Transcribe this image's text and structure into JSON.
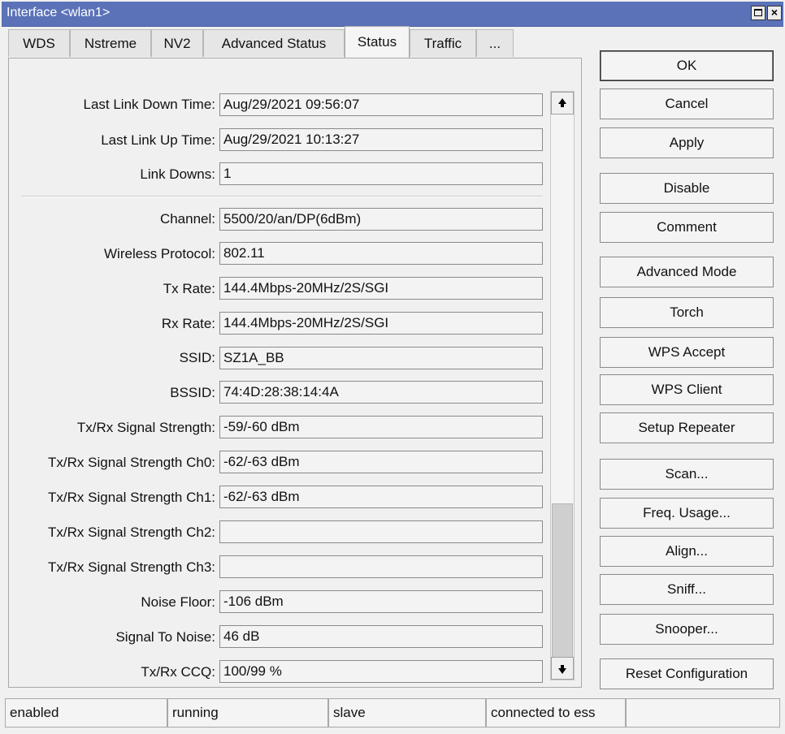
{
  "window": {
    "title": "Interface <wlan1>"
  },
  "tabs": [
    {
      "label": "WDS",
      "active": false
    },
    {
      "label": "Nstreme",
      "active": false
    },
    {
      "label": "NV2",
      "active": false
    },
    {
      "label": "Advanced Status",
      "active": false
    },
    {
      "label": "Status",
      "active": true
    },
    {
      "label": "Traffic",
      "active": false
    },
    {
      "label": "...",
      "active": false
    }
  ],
  "status_fields": [
    {
      "label": "Last Link Down Time:",
      "value": "Aug/29/2021 09:56:07"
    },
    {
      "label": "Last Link Up Time:",
      "value": "Aug/29/2021 10:13:27"
    },
    {
      "label": "Link Downs:",
      "value": "1"
    },
    {
      "label": "Channel:",
      "value": "5500/20/an/DP(6dBm)"
    },
    {
      "label": "Wireless Protocol:",
      "value": "802.11"
    },
    {
      "label": "Tx Rate:",
      "value": "144.4Mbps-20MHz/2S/SGI"
    },
    {
      "label": "Rx Rate:",
      "value": "144.4Mbps-20MHz/2S/SGI"
    },
    {
      "label": "SSID:",
      "value": "SZ1A_BB"
    },
    {
      "label": "BSSID:",
      "value": "74:4D:28:38:14:4A"
    },
    {
      "label": "Tx/Rx Signal Strength:",
      "value": "-59/-60 dBm"
    },
    {
      "label": "Tx/Rx Signal Strength Ch0:",
      "value": "-62/-63 dBm"
    },
    {
      "label": "Tx/Rx Signal Strength Ch1:",
      "value": "-62/-63 dBm"
    },
    {
      "label": "Tx/Rx Signal Strength Ch2:",
      "value": ""
    },
    {
      "label": "Tx/Rx Signal Strength Ch3:",
      "value": ""
    },
    {
      "label": "Noise Floor:",
      "value": "-106 dBm"
    },
    {
      "label": "Signal To Noise:",
      "value": "46 dB"
    },
    {
      "label": "Tx/Rx CCQ:",
      "value": "100/99 %"
    }
  ],
  "buttons": [
    "OK",
    "Cancel",
    "Apply",
    "Disable",
    "Comment",
    "Advanced Mode",
    "Torch",
    "WPS Accept",
    "WPS Client",
    "Setup Repeater",
    "Scan...",
    "Freq. Usage...",
    "Align...",
    "Sniff...",
    "Snooper...",
    "Reset Configuration"
  ],
  "status_bar": [
    "enabled",
    "running",
    "slave",
    "connected to ess",
    ""
  ],
  "icons": {
    "maximize": "maximize-icon",
    "close": "close-icon",
    "scroll_up": "arrow-up-icon",
    "scroll_down": "arrow-down-icon"
  },
  "colors": {
    "titlebar": "#5b72b8",
    "window_bg": "#f0f0f0"
  }
}
